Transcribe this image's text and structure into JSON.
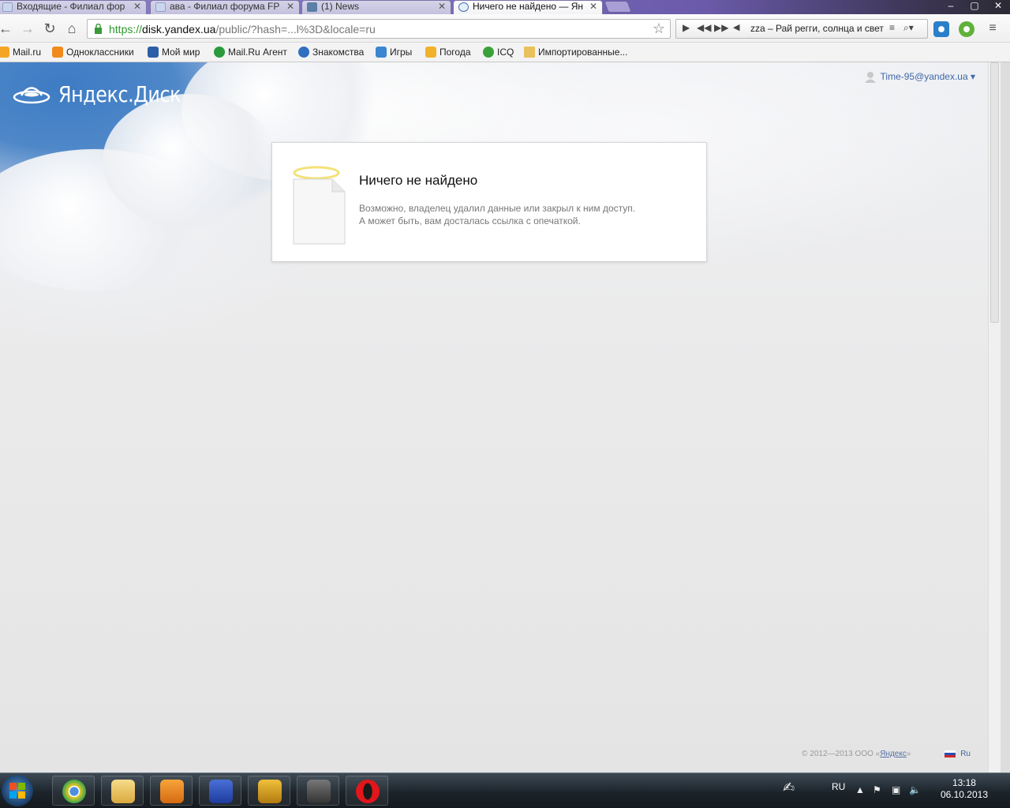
{
  "browser": {
    "tabs": [
      {
        "title": "Входящие - Филиал фор",
        "active": false
      },
      {
        "title": "ава - Филиал форума FP",
        "active": false
      },
      {
        "title": "(1) News",
        "active": false
      },
      {
        "title": "Ничего не найдено — Ян",
        "active": true
      }
    ],
    "address": {
      "scheme": "https://",
      "host": "disk.yandex.ua",
      "path": "/public/?hash=...l%3D&locale=ru"
    },
    "player": {
      "track": "zza – Рай регги, солнца и свет"
    },
    "bookmarks": [
      {
        "label": "Mail.ru",
        "icon": "mailru-icon",
        "color": "#f4a623"
      },
      {
        "label": "Одноклассники",
        "icon": "odnoklassniki-icon",
        "color": "#f08a1c"
      },
      {
        "label": "Мой мир",
        "icon": "moimir-icon",
        "color": "#2d5ea8"
      },
      {
        "label": "Mail.Ru Агент",
        "icon": "agent-icon",
        "color": "#2a9a3c"
      },
      {
        "label": "Знакомства",
        "icon": "at-icon",
        "color": "#2f6fbf"
      },
      {
        "label": "Игры",
        "icon": "at-icon",
        "color": "#3a86d0"
      },
      {
        "label": "Погода",
        "icon": "weather-icon",
        "color": "#f2b12b"
      },
      {
        "label": "ICQ",
        "icon": "icq-icon",
        "color": "#3aa13a"
      },
      {
        "label": "Импортированные...",
        "icon": "folder-icon",
        "color": "#e8c15c"
      }
    ]
  },
  "page": {
    "brand": "Яндекс.Диск",
    "user": "Time-95@yandex.ua ▾",
    "card": {
      "title": "Ничего не найдено",
      "line1": "Возможно, владелец удалил данные или закрыл к ним доступ.",
      "line2": "А может быть, вам досталась ссылка с опечаткой."
    },
    "footer": {
      "copyright_prefix": "© 2012—2013 ООО «",
      "company": "Яндекс",
      "copyright_suffix": "»",
      "lang": "Ru"
    }
  },
  "taskbar": {
    "language": "RU",
    "time": "13:18",
    "date": "06.10.2013"
  },
  "colors": {
    "link": "#3f67a8",
    "url_scheme": "#2b9a2b"
  }
}
